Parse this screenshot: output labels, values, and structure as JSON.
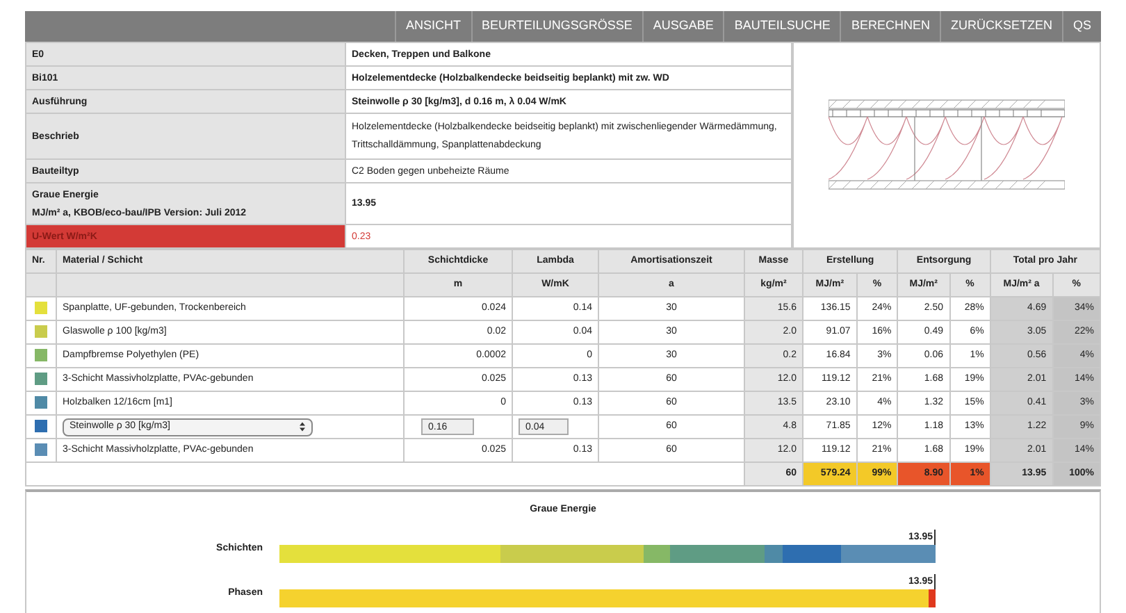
{
  "nav": [
    "ANSICHT",
    "BEURTEILUNGSGRÖSSE",
    "AUSGABE",
    "BAUTEILSUCHE",
    "BERECHNEN",
    "ZURÜCKSETZEN",
    "QS"
  ],
  "info": [
    {
      "label": [
        "E0"
      ],
      "value": "Decken, Treppen und Balkone",
      "bold": true,
      "warning": false
    },
    {
      "label": [
        "Bi101"
      ],
      "value": "Holzelementdecke (Holzbalkendecke beidseitig beplankt) mit zw. WD",
      "bold": true,
      "warning": false
    },
    {
      "label": [
        "Ausführung"
      ],
      "value": "Steinwolle ρ 30 [kg/m3], d 0.16 m, λ 0.04 W/mK",
      "bold": true,
      "warning": false
    },
    {
      "label": [
        "Beschrieb"
      ],
      "value": "Holzelementdecke (Holzbalkendecke beidseitig beplankt) mit zwischenliegender Wärmedämmung, Trittschalldämmung, Spanplattenabdeckung",
      "bold": false,
      "warning": false
    },
    {
      "label": [
        "Bauteiltyp"
      ],
      "value": "C2 Boden gegen unbeheizte Räume",
      "bold": false,
      "warning": false
    },
    {
      "label": [
        "Graue Energie",
        "MJ/m² a, KBOB/eco-bau/IPB Version: Juli 2012"
      ],
      "value": "13.95",
      "bold": true,
      "warning": false
    },
    {
      "label": [
        "U-Wert W/m²K"
      ],
      "value": "0.23",
      "bold": false,
      "warning": true
    }
  ],
  "table": {
    "header": [
      "Nr.",
      "Material / Schicht",
      "Schichtdicke",
      "Lambda",
      "Amortisationszeit",
      "Masse",
      "Erstellung",
      "Entsorgung",
      "Total pro Jahr"
    ],
    "units": [
      "m",
      "W/mK",
      "a",
      "kg/m²",
      "MJ/m²",
      "%",
      "MJ/m²",
      "%",
      "MJ/m² a",
      "%"
    ],
    "rows": [
      {
        "kind": "text",
        "color": "#e4e03c",
        "name": "Spanplatte, UF-gebunden, Trockenbereich",
        "thickness": "0.024",
        "lambda": "0.14",
        "amort": "30",
        "mass": "15.6",
        "erst": "136.15",
        "erst_pct": "24%",
        "ents": "2.50",
        "ents_pct": "28%",
        "total": "4.69",
        "total_pct": "34%"
      },
      {
        "kind": "text",
        "color": "#c9cc4c",
        "name": "Glaswolle ρ 100 [kg/m3]",
        "thickness": "0.02",
        "lambda": "0.04",
        "amort": "30",
        "mass": "2.0",
        "erst": "91.07",
        "erst_pct": "16%",
        "ents": "0.49",
        "ents_pct": "6%",
        "total": "3.05",
        "total_pct": "22%"
      },
      {
        "kind": "text",
        "color": "#86b866",
        "name": "Dampfbremse Polyethylen (PE)",
        "thickness": "0.0002",
        "lambda": "0",
        "amort": "30",
        "mass": "0.2",
        "erst": "16.84",
        "erst_pct": "3%",
        "ents": "0.06",
        "ents_pct": "1%",
        "total": "0.56",
        "total_pct": "4%"
      },
      {
        "kind": "text",
        "color": "#5f9c84",
        "name": "3-Schicht Massivholzplatte, PVAc-gebunden",
        "thickness": "0.025",
        "lambda": "0.13",
        "amort": "60",
        "mass": "12.0",
        "erst": "119.12",
        "erst_pct": "21%",
        "ents": "1.68",
        "ents_pct": "19%",
        "total": "2.01",
        "total_pct": "14%"
      },
      {
        "kind": "text",
        "color": "#4f8aa6",
        "name": "Holzbalken 12/16cm [m1]",
        "thickness": "0",
        "lambda": "0.13",
        "amort": "60",
        "mass": "13.5",
        "erst": "23.10",
        "erst_pct": "4%",
        "ents": "1.32",
        "ents_pct": "15%",
        "total": "0.41",
        "total_pct": "3%"
      },
      {
        "kind": "select",
        "color": "#2e6eb0",
        "name": "Steinwolle ρ 30 [kg/m3]",
        "thickness": "0.16",
        "lambda": "0.04",
        "amort": "60",
        "mass": "4.8",
        "erst": "71.85",
        "erst_pct": "12%",
        "ents": "1.18",
        "ents_pct": "13%",
        "total": "1.22",
        "total_pct": "9%"
      },
      {
        "kind": "text",
        "color": "#5a8db4",
        "name": "3-Schicht Massivholzplatte, PVAc-gebunden",
        "thickness": "0.025",
        "lambda": "0.13",
        "amort": "60",
        "mass": "12.0",
        "erst": "119.12",
        "erst_pct": "21%",
        "ents": "1.68",
        "ents_pct": "19%",
        "total": "2.01",
        "total_pct": "14%"
      }
    ],
    "totals": {
      "mass": "60",
      "erst": "579.24",
      "erst_pct": "99%",
      "ents": "8.90",
      "ents_pct": "1%",
      "total": "13.95",
      "total_pct": "100%"
    }
  },
  "chart": {
    "title": "Graue Energie",
    "bars": [
      {
        "label": "Schichten",
        "total": "13.95",
        "segments": [
          {
            "color": "#e4e03c"
          },
          {
            "color": "#c9cc4c"
          },
          {
            "color": "#86b866"
          },
          {
            "color": "#5f9c84"
          },
          {
            "color": "#4f8aa6"
          },
          {
            "color": "#2e6eb0"
          },
          {
            "color": "#5a8db4"
          }
        ]
      },
      {
        "label": "Phasen",
        "total": "13.95",
        "segments": [
          {
            "color": "#f5d22e"
          },
          {
            "color": "#e0391e"
          }
        ]
      }
    ]
  }
}
